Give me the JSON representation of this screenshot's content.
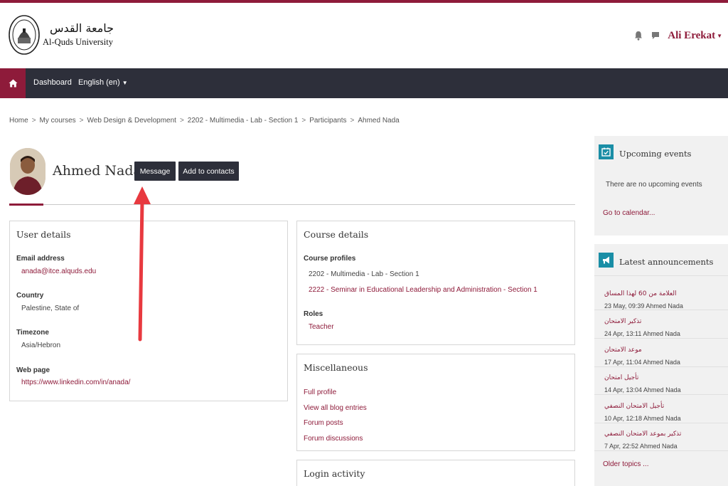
{
  "header": {
    "university_ar": "جامعة القدس",
    "university_en": "Al-Quds University",
    "user_name": "Ali Erekat"
  },
  "navbar": {
    "dashboard": "Dashboard",
    "language": "English (en)"
  },
  "breadcrumb": [
    "Home",
    "My courses",
    "Web Design & Development",
    "2202 - Multimedia - Lab - Section 1",
    "Participants",
    "Ahmed Nada"
  ],
  "profile": {
    "name": "Ahmed Nada",
    "message_button": "Message",
    "add_contacts_button": "Add to contacts"
  },
  "user_details": {
    "title": "User details",
    "email_label": "Email address",
    "email": "anada@itce.alquds.edu",
    "country_label": "Country",
    "country": "Palestine, State of",
    "timezone_label": "Timezone",
    "timezone": "Asia/Hebron",
    "webpage_label": "Web page",
    "webpage": "https://www.linkedin.com/in/anada/"
  },
  "course_details": {
    "title": "Course details",
    "profiles_label": "Course profiles",
    "course_1": "2202 - Multimedia - Lab - Section 1",
    "course_2": "2222 - Seminar in Educational Leadership and Administration - Section 1",
    "roles_label": "Roles",
    "role": "Teacher"
  },
  "misc": {
    "title": "Miscellaneous",
    "links": [
      "Full profile",
      "View all blog entries",
      "Forum posts",
      "Forum discussions"
    ]
  },
  "login_activity": {
    "title": "Login activity"
  },
  "upcoming_events": {
    "title": "Upcoming events",
    "empty_text": "There are no upcoming events",
    "calendar_link": "Go to calendar..."
  },
  "announcements": {
    "title": "Latest announcements",
    "items": [
      {
        "title": "العلامة من 60 لهذا المساق",
        "meta": "23 May, 09:39  Ahmed Nada"
      },
      {
        "title": "تذكير الامتحان",
        "meta": "24 Apr, 13:11  Ahmed Nada"
      },
      {
        "title": "موعد الامتحان",
        "meta": "17 Apr, 11:04  Ahmed Nada"
      },
      {
        "title": "تأجيل امتحان",
        "meta": "14 Apr, 13:04  Ahmed Nada"
      },
      {
        "title": "تأجيل الامتحان النصفي",
        "meta": "10 Apr, 12:18  Ahmed Nada"
      },
      {
        "title": "تذكير بموعد الامتحان النصفي",
        "meta": "7 Apr, 22:52  Ahmed Nada"
      }
    ],
    "older_link": "Older topics ..."
  },
  "colors": {
    "brand": "#8e1b3a",
    "navbar": "#2d2f3a",
    "block_icon": "#1a8ea6",
    "annotation_arrow": "#e8393f"
  }
}
